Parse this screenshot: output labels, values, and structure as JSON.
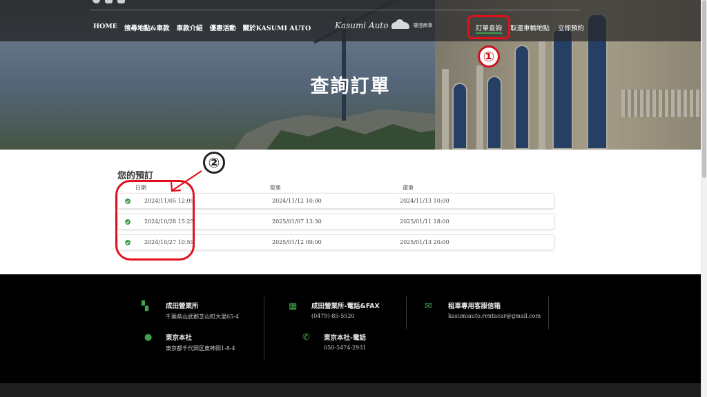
{
  "nav": {
    "home": "HOME",
    "search": "搜尋地點&車款",
    "cars": "車款介紹",
    "promo": "優惠活動",
    "about": "關於KASUMI AUTO",
    "logo_text": "Kasumi Auto",
    "logo_sub": "樓澄商事",
    "order_lookup": "訂單查詢",
    "pickup_locations": "取還車輛地點",
    "book_now": "立即預約"
  },
  "hero": {
    "title": "查詢訂單"
  },
  "annotations": {
    "one": "①",
    "two": "②"
  },
  "reservations": {
    "title": "您的預訂",
    "headers": {
      "date": "日期",
      "pickup": "取車",
      "return": "還車"
    },
    "rows": [
      {
        "date": "2024/11/05 12:09",
        "pickup": "2024/11/12 10:00",
        "return": "2024/11/13 10:00"
      },
      {
        "date": "2024/10/28 15:25",
        "pickup": "2025/01/07 13:30",
        "return": "2025/01/11 18:00"
      },
      {
        "date": "2024/10/27 10:59",
        "pickup": "2025/01/12 09:00",
        "return": "2025/01/13 20:00"
      }
    ]
  },
  "footer": {
    "narita_office": {
      "title": "成田營業所",
      "text": "千葉県山武郡芝山町大里65-4"
    },
    "narita_phone": {
      "title": "成田營業所-電話&FAX",
      "text": "(0479)-85-5520"
    },
    "email": {
      "title": "租車專用客服信箱",
      "text": "kasumiauto.rentacar@gmail.com"
    },
    "tokyo_office": {
      "title": "東京本社",
      "text": "東京都千代田区東神田1-8-4"
    },
    "tokyo_phone": {
      "title": "東京本社-電話",
      "text": "050-5474-2931"
    }
  },
  "colors": {
    "accent_green": "#3fa34d",
    "annotation_red": "#e0101c",
    "footer_bg": "#000000"
  },
  "icons": [
    "facebook-icon",
    "instagram-icon",
    "mail-icon",
    "map-icon",
    "fax-icon",
    "envelope-icon",
    "location-pin-icon",
    "phone-icon",
    "check-circle-icon"
  ]
}
